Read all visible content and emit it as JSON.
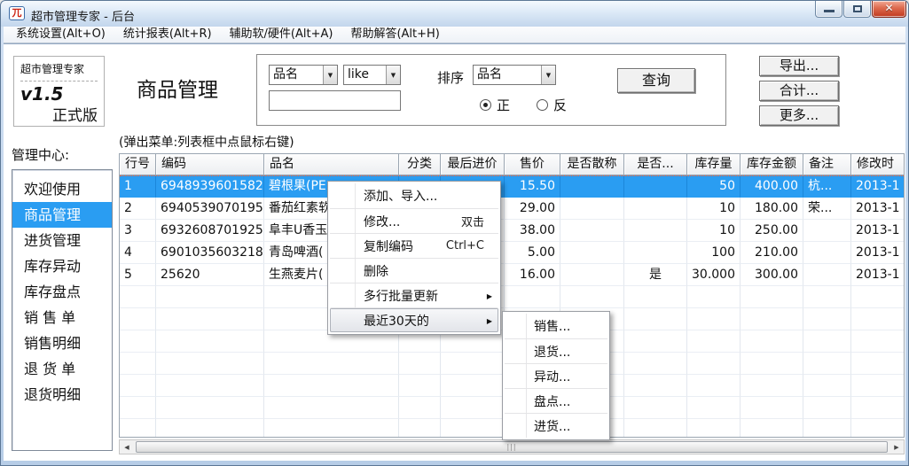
{
  "window": {
    "title": "超市管理专家 - 后台",
    "icon_glyph": "兀"
  },
  "menubar": [
    "系统设置(Alt+O)",
    "统计报表(Alt+R)",
    "辅助软/硬件(Alt+A)",
    "帮助解答(Alt+H)"
  ],
  "brand": {
    "name": "超市管理专家",
    "version": "v1.5",
    "edition": "正式版"
  },
  "page_title": "商品管理",
  "search": {
    "field": "品名",
    "operator": "like",
    "keyword": "",
    "sort_label": "排序",
    "sort_field": "品名",
    "order_options": [
      {
        "label": "正",
        "selected": true
      },
      {
        "label": "反",
        "selected": false
      }
    ],
    "query": "查询"
  },
  "actions": [
    "导出...",
    "合计...",
    "更多..."
  ],
  "sidebar": {
    "title": "管理中心:",
    "items": [
      {
        "label": "欢迎使用",
        "selected": false
      },
      {
        "label": "商品管理",
        "selected": true
      },
      {
        "label": "进货管理",
        "selected": false
      },
      {
        "label": "库存异动",
        "selected": false
      },
      {
        "label": "库存盘点",
        "selected": false
      },
      {
        "label": "销 售 单",
        "selected": false
      },
      {
        "label": "销售明细",
        "selected": false
      },
      {
        "label": "退 货 单",
        "selected": false
      },
      {
        "label": "退货明细",
        "selected": false
      }
    ]
  },
  "hint": "(弹出菜单:列表框中点鼠标右键)",
  "table": {
    "columns": [
      {
        "label": "行号",
        "width": 41,
        "align": "left"
      },
      {
        "label": "编码",
        "width": 122,
        "align": "left"
      },
      {
        "label": "品名",
        "width": 152,
        "align": "left"
      },
      {
        "label": "分类",
        "width": 47,
        "align": "center"
      },
      {
        "label": "最后进价",
        "width": 72,
        "align": "center"
      },
      {
        "label": "售价",
        "width": 63,
        "align": "right"
      },
      {
        "label": "是否散称",
        "width": 72,
        "align": "center"
      },
      {
        "label": "是否...",
        "width": 71,
        "align": "center"
      },
      {
        "label": "库存量",
        "width": 60,
        "align": "right"
      },
      {
        "label": "库存金额",
        "width": 71,
        "align": "right"
      },
      {
        "label": "备注",
        "width": 54,
        "align": "left"
      },
      {
        "label": "修改时",
        "width": 80,
        "align": "left"
      }
    ],
    "rows": [
      {
        "selected": true,
        "cells": [
          "1",
          "6948939601582",
          "碧根果(PE",
          "",
          "",
          "15.50",
          "",
          "",
          "50",
          "400.00",
          "杭...",
          "2013-1"
        ]
      },
      {
        "selected": false,
        "cells": [
          "2",
          "6940539070195",
          "番茄红素软",
          "",
          "",
          "29.00",
          "",
          "",
          "10",
          "180.00",
          "荣...",
          "2013-1"
        ]
      },
      {
        "selected": false,
        "cells": [
          "3",
          "6932608701925",
          "阜丰U香玉",
          "",
          "",
          "38.00",
          "",
          "",
          "10",
          "250.00",
          "",
          "2013-1"
        ]
      },
      {
        "selected": false,
        "cells": [
          "4",
          "6901035603218",
          "青岛啤酒(",
          "",
          "",
          "5.00",
          "",
          "",
          "100",
          "210.00",
          "",
          "2013-1"
        ]
      },
      {
        "selected": false,
        "cells": [
          "5",
          "25620",
          "生燕麦片(",
          "",
          "",
          "16.00",
          "",
          "是",
          "30.000",
          "300.00",
          "",
          "2013-1"
        ]
      }
    ]
  },
  "context_menu": {
    "items": [
      {
        "label": "添加、导入...",
        "shortcut": "",
        "submenu": false,
        "highlighted": false
      },
      {
        "label": "修改...",
        "shortcut": "双击",
        "submenu": false,
        "highlighted": false
      },
      {
        "label": "复制编码",
        "shortcut": "Ctrl+C",
        "submenu": false,
        "highlighted": false
      },
      {
        "label": "删除",
        "shortcut": "",
        "submenu": false,
        "highlighted": false
      },
      {
        "label": "多行批量更新",
        "shortcut": "",
        "submenu": true,
        "highlighted": false
      },
      {
        "label": "最近30天的",
        "shortcut": "",
        "submenu": true,
        "highlighted": true
      }
    ]
  },
  "submenu": {
    "items": [
      "销售...",
      "退货...",
      "异动...",
      "盘点...",
      "进货..."
    ]
  },
  "colors": {
    "selection_blue": "#2a9df2",
    "focus_orange": "#ff5f2e",
    "close_red": "#bf3a20"
  }
}
